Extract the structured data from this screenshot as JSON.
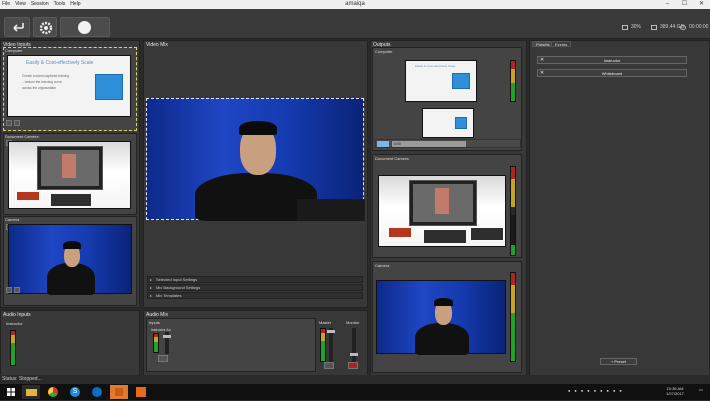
{
  "app": {
    "title": "amaiqa",
    "menu": [
      "File",
      "View",
      "Session",
      "Tools",
      "Help"
    ],
    "window_controls": [
      "minimize-icon",
      "maximize-icon",
      "close-icon"
    ]
  },
  "toolbar": {
    "buttons": [
      "exit-icon",
      "gear-icon",
      "record-icon"
    ],
    "stats": [
      {
        "icon": "cpu-icon",
        "value": "30%"
      },
      {
        "icon": "disk-icon",
        "value": "389.44 GB"
      },
      {
        "icon": "clock-icon",
        "value": "00:00:00"
      }
    ]
  },
  "video_inputs": {
    "title": "Video Inputs",
    "sources": [
      {
        "label": "Computer",
        "slide_title": "Easily & Cost-effectively Scale",
        "slide_text": [
          "Create custom-captured training",
          "...reduce the learning curve",
          "across the organization"
        ]
      },
      {
        "label": "Document Camera"
      },
      {
        "label": "Camera"
      }
    ]
  },
  "video_mix": {
    "title": "Video Mix",
    "settings": [
      "Selected Input Settings",
      "Mix Background Settings",
      "Mix Templates"
    ]
  },
  "outputs": {
    "title": "Outputs",
    "sections": [
      "Computer",
      "Document Camera",
      "Camera"
    ],
    "slide_title": "Easily & Cost-effectively Scale",
    "caption_small": "0:00"
  },
  "audio_inputs": {
    "title": "Audio Inputs",
    "channel": "Instructor"
  },
  "audio_mix": {
    "title": "Audio Mix",
    "inputs_label": "Inputs",
    "input_name": "Instructor Au",
    "master_label": "Master",
    "monitor_label": "Monitor"
  },
  "presets": {
    "tabs": [
      "Presets",
      "Events"
    ],
    "items": [
      "Instructor",
      "Whiteboard"
    ],
    "add_button": "+ Preset"
  },
  "status": {
    "text": "Status: Stopped..."
  },
  "taskbar": {
    "apps": [
      "windows-icon",
      "file-explorer-icon",
      "chrome-icon",
      "skype-icon",
      "skype-business-icon",
      "amaiqa-app-icon",
      "uploader-icon"
    ],
    "time": "10:36 AM",
    "date": "1/27/2017"
  },
  "colors": {
    "meter_green": "#1ea327",
    "meter_yellow": "#c7a31f",
    "meter_red": "#b0261e",
    "selection": "#d8d870"
  }
}
